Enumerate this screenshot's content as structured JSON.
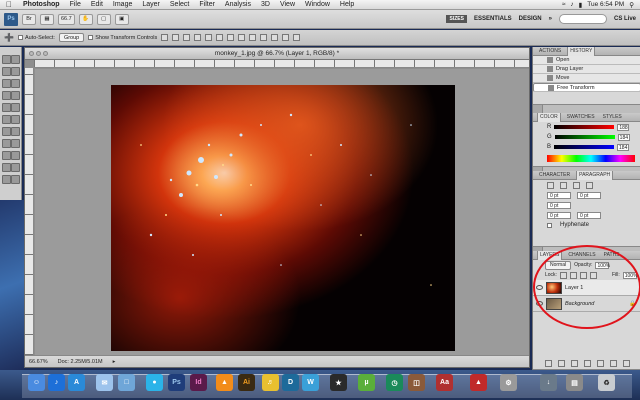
{
  "menubar": {
    "app": "Photoshop",
    "items": [
      "File",
      "Edit",
      "Image",
      "Layer",
      "Select",
      "Filter",
      "Analysis",
      "3D",
      "View",
      "Window",
      "Help"
    ],
    "clock": "Tue 6:54 PM"
  },
  "appbar": {
    "logo": "Ps",
    "zoom": "66.7",
    "workspace_badge": "SIZES",
    "workspaces": [
      "ESSENTIALS",
      "DESIGN"
    ],
    "cs_live": "CS Live"
  },
  "options": {
    "auto_select_label": "Auto-Select:",
    "auto_select_value": "Group",
    "transform_label": "Show Transform Controls"
  },
  "document": {
    "title": "monkey_1.jpg @ 66.7% (Layer 1, RGB/8) *",
    "status_zoom": "66.67%",
    "status_doc": "Doc: 2.25M/5.01M"
  },
  "history": {
    "tabs": [
      "ACTIONS",
      "HISTORY"
    ],
    "items": [
      "Open",
      "Drag Layer",
      "Move",
      "Free Transform"
    ]
  },
  "color": {
    "tabs": [
      "COLOR",
      "SWATCHES",
      "STYLES"
    ],
    "channels": [
      {
        "name": "R",
        "value": "188"
      },
      {
        "name": "G",
        "value": "184"
      },
      {
        "name": "B",
        "value": "184"
      }
    ]
  },
  "character": {
    "tabs": [
      "CHARACTER",
      "PARAGRAPH"
    ],
    "fields": [
      "0 pt",
      "0 pt",
      "0 pt",
      "0 pt",
      "0 pt"
    ],
    "hyphenate": "Hyphenate"
  },
  "layers": {
    "tabs": [
      "LAYERS",
      "CHANNELS",
      "PATHS"
    ],
    "blend": "Normal",
    "opacity_label": "Opacity:",
    "opacity": "100%",
    "lock_label": "Lock:",
    "fill_label": "Fill:",
    "fill": "100%",
    "items": [
      "Layer 1",
      "Background"
    ]
  },
  "dock": {
    "icons": [
      "finder-icon",
      "itunes-icon",
      "appstore-icon",
      "mail-icon",
      "preview-icon",
      "photoshop-icon",
      "indesign-icon",
      "vlc-icon",
      "illustrator-icon",
      "sound-icon",
      "dreamweaver-icon",
      "pw-icon",
      "games-icon",
      "utorrent-icon",
      "photos-icon",
      "dictionary-icon",
      "acrobat-icon",
      "system-icon",
      "trash-icon"
    ]
  },
  "accent": "#e0141c"
}
